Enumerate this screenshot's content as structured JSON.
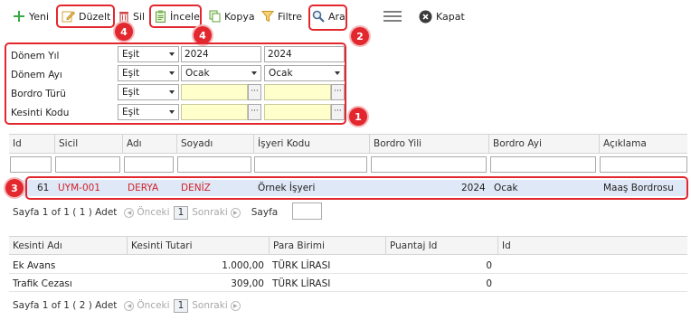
{
  "toolbar": {
    "new_label": "Yeni",
    "edit_label": "Düzelt",
    "delete_label": "Sil",
    "inspect_label": "İncele",
    "copy_label": "Kopya",
    "filter_label": "Filtre",
    "search_label": "Ara",
    "close_label": "Kapat"
  },
  "badges": {
    "b1": "1",
    "b2": "2",
    "b3": "3",
    "b4a": "4",
    "b4b": "4"
  },
  "filters": [
    {
      "label": "Dönem Yıl",
      "op": "Eşit",
      "v1": "2024",
      "v2": "2024"
    },
    {
      "label": "Dönem Ayı",
      "op": "Eşit",
      "v1": "Ocak",
      "v2": "Ocak"
    },
    {
      "label": "Bordro Türü",
      "op": "Eşit",
      "v1": "",
      "v2": ""
    },
    {
      "label": "Kesinti Kodu",
      "op": "Eşit",
      "v1": "",
      "v2": ""
    }
  ],
  "grid1": {
    "columns": [
      "Id",
      "Sicil",
      "Adı",
      "Soyadı",
      "İşyeri Kodu",
      "Bordro Yili",
      "Bordro Ayi",
      "Açıklama"
    ],
    "row": {
      "id": "61",
      "sicil": "UYM-001",
      "adi": "DERYA",
      "soyadi": "DENİZ",
      "isyeri": "Örnek İşyeri",
      "yil": "2024",
      "ay": "Ocak",
      "aciklama": "Maaş Bordrosu"
    },
    "pager": {
      "info": "Sayfa 1 of 1 ( 1 ) Adet",
      "prev": "Önceki",
      "page": "1",
      "next": "Sonraki",
      "goto": "Sayfa"
    }
  },
  "grid2": {
    "columns": [
      "Kesinti Adı",
      "Kesinti Tutari",
      "Para Birimi",
      "Puantaj Id",
      "Id"
    ],
    "rows": [
      {
        "ad": "Ek Avans",
        "tutar": "1.000,00",
        "para": "TÜRK LİRASI",
        "puantaj": "0"
      },
      {
        "ad": "Trafik Cezası",
        "tutar": "309,00",
        "para": "TÜRK LİRASI",
        "puantaj": "0"
      }
    ],
    "pager": {
      "info": "Sayfa 1 of 1 ( 2 ) Adet",
      "prev": "Önceki",
      "page": "1",
      "next": "Sonraki"
    }
  },
  "colors": {
    "accent_red": "#e2282e",
    "selected_row": "#dfe8f6",
    "required_field": "#ffffcc"
  }
}
